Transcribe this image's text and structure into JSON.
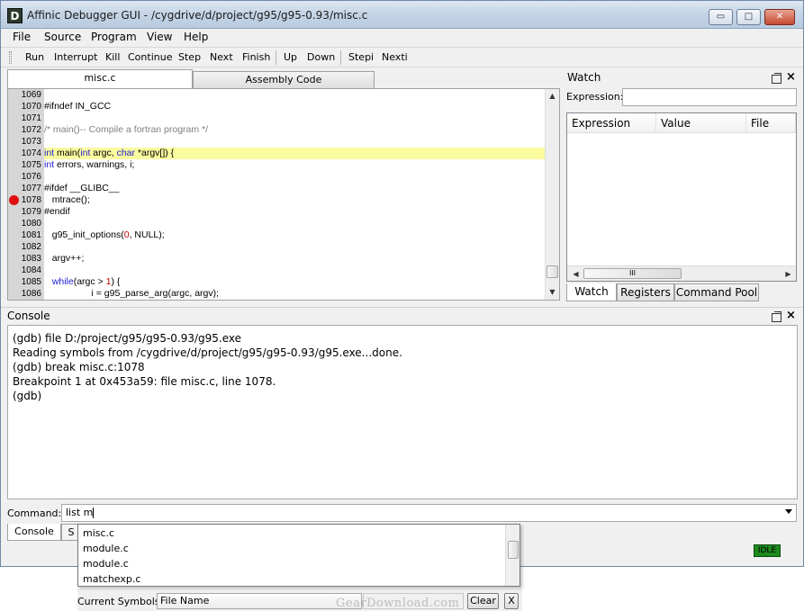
{
  "window": {
    "icon_letter": "D",
    "title": "Affinic Debugger GUI - /cygdrive/d/project/g95/g95-0.93/misc.c",
    "minimize_label": "▭",
    "maximize_label": "□",
    "close_label": "✕"
  },
  "menu": [
    "File",
    "Source",
    "Program",
    "View",
    "Help"
  ],
  "toolbar": [
    "Run",
    "Interrupt",
    "Kill",
    "Continue",
    "Step",
    "Next",
    "Finish",
    "Up",
    "Down",
    "Stepi",
    "Nexti"
  ],
  "editor": {
    "tabs": [
      "misc.c",
      "Assembly Code"
    ],
    "breakpoint_line": "1078",
    "lines": [
      {
        "no": "1069",
        "text": ""
      },
      {
        "no": "1070",
        "text": "#ifndef IN_GCC"
      },
      {
        "no": "1071",
        "text": ""
      },
      {
        "no": "1072",
        "text": "/* main()-- Compile a fortran program */"
      },
      {
        "no": "1073",
        "text": ""
      },
      {
        "no": "1074",
        "text": "int main(int argc, char *argv[]) {"
      },
      {
        "no": "1075",
        "text": "int errors, warnings, i;"
      },
      {
        "no": "1076",
        "text": ""
      },
      {
        "no": "1077",
        "text": "#ifdef __GLIBC__"
      },
      {
        "no": "1078",
        "text": "   mtrace();"
      },
      {
        "no": "1079",
        "text": "#endif"
      },
      {
        "no": "1080",
        "text": ""
      },
      {
        "no": "1081",
        "text": "   g95_init_options(0, NULL);"
      },
      {
        "no": "1082",
        "text": ""
      },
      {
        "no": "1083",
        "text": "   argv++;"
      },
      {
        "no": "1084",
        "text": ""
      },
      {
        "no": "1085",
        "text": "   while(argc > 1) {"
      },
      {
        "no": "1086",
        "text": "                  i = g95_parse_arg(argc, argv);"
      }
    ]
  },
  "watch": {
    "title": "Watch",
    "expression_label": "Expression:",
    "expression_value": "",
    "columns": [
      "Expression",
      "Value",
      "File"
    ],
    "hscroll_grip": "III",
    "tabs": [
      "Watch",
      "Registers",
      "Command Pool"
    ]
  },
  "console": {
    "title": "Console",
    "lines": [
      "(gdb) file D:/project/g95/g95-0.93/g95.exe",
      "Reading symbols from /cygdrive/d/project/g95/g95-0.93/g95.exe...done.",
      "(gdb) break misc.c:1078",
      "Breakpoint 1 at 0x453a59: file misc.c, line 1078.",
      "(gdb)"
    ],
    "command_label": "Command:",
    "command_value": "list m",
    "tabs": [
      "Console",
      "S"
    ]
  },
  "autocomplete": [
    "misc.c",
    "module.c",
    "module.c",
    "matchexp.c"
  ],
  "symbols": {
    "label": "Current Symbols:",
    "field": "File Name",
    "clear_label": "Clear",
    "close_label": "X"
  },
  "status": {
    "badge": "IDLE"
  },
  "watermark": "GearDownload.com",
  "colors": {
    "current_line": "#fbfb9f",
    "breakpoint": "#e01010",
    "keyword": "#1b1bd0",
    "comment": "#808080",
    "number": "#c00000",
    "idle_badge": "#1d8a1d"
  }
}
